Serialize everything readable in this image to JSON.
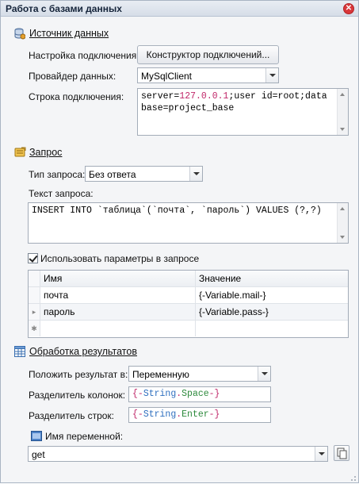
{
  "window": {
    "title": "Работа с базами данных"
  },
  "source": {
    "heading": "Источник данных",
    "connection_setup_label": "Настройка подключения:",
    "connection_builder_button": "Конструктор подключений...",
    "provider_label": "Провайдер данных:",
    "provider_value": "MySqlClient",
    "connstring_label": "Строка подключения:",
    "connstring_parts": [
      "server=",
      "127.0.0.1",
      ";user id=root;data base=project_base"
    ]
  },
  "query": {
    "heading": "Запрос",
    "type_label": "Тип запроса:",
    "type_value": "Без ответа",
    "text_label": "Текст запроса:",
    "text_value": "INSERT INTO `таблица`(`почта`, `пароль`) VALUES (?,?)",
    "use_params_label": "Использовать параметры в запросе",
    "params": {
      "col_name": "Имя",
      "col_value": "Значение",
      "rows": [
        {
          "name": "почта",
          "value": "{-Variable.mail-}"
        },
        {
          "name": "пароль",
          "value": "{-Variable.pass-}"
        }
      ],
      "new_row_marker": "✱"
    }
  },
  "results": {
    "heading": "Обработка результатов",
    "put_result_label": "Положить результат в:",
    "put_result_value": "Переменную",
    "col_separator_label": "Разделитель колонок:",
    "col_separator": {
      "open": "{-",
      "fn": "String",
      "dot": ".",
      "arg": "Space",
      "close": "-}"
    },
    "row_separator_label": "Разделитель строк:",
    "row_separator": {
      "open": "{-",
      "fn": "String",
      "dot": ".",
      "arg": "Enter",
      "close": "-}"
    },
    "var_name_label": "Имя переменной:",
    "var_name_value": "get"
  },
  "colors": {
    "accent_red": "#d9373a",
    "token_pink": "#c0286a",
    "token_blue": "#2e6fbf",
    "token_green": "#2d8a3c"
  }
}
